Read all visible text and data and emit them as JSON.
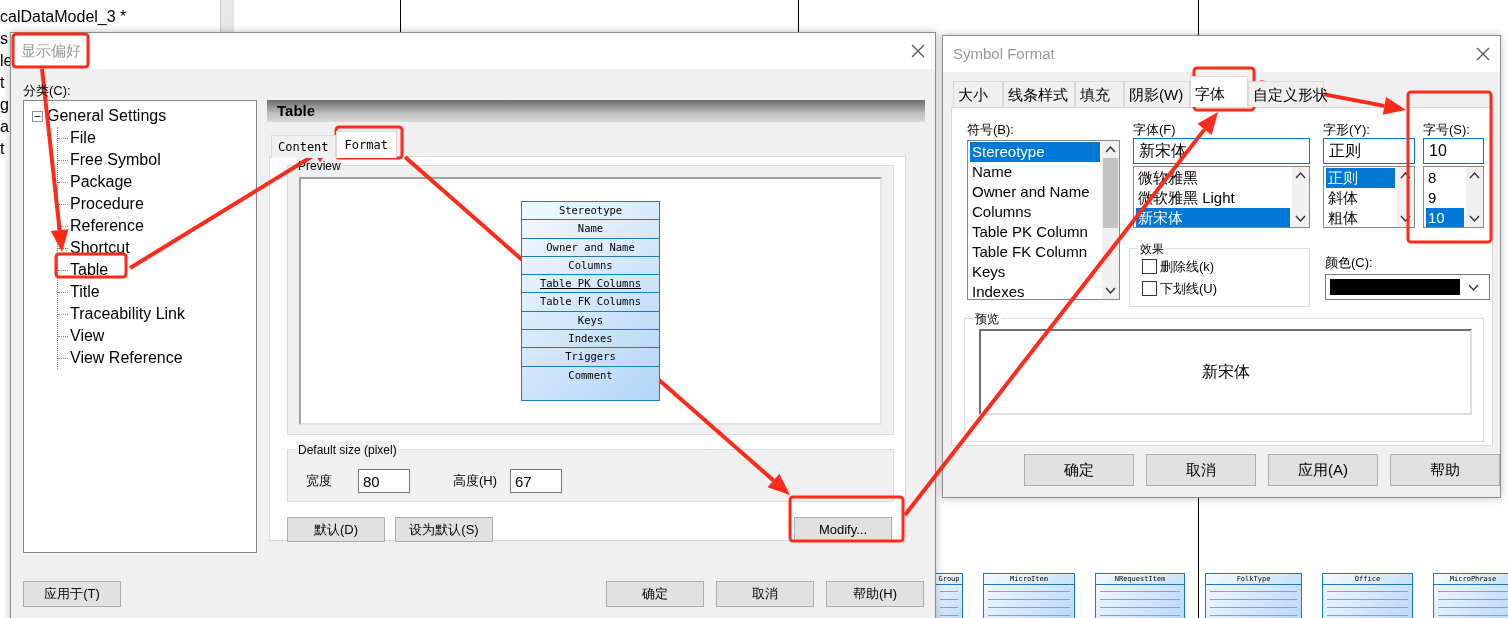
{
  "background": {
    "model_title": "calDataModel_3 *",
    "cut_labels": [
      "s",
      "le",
      "t",
      "g",
      "a",
      "t"
    ],
    "diagram_tables": [
      {
        "title": "Group"
      },
      {
        "title": "MicroItem"
      },
      {
        "title": "NRequestItem"
      },
      {
        "title": "FolkType"
      },
      {
        "title": "Office"
      },
      {
        "title": "MicroPhrase"
      }
    ]
  },
  "preferences_dialog": {
    "title": "显示偏好",
    "category_label": "分类(C):",
    "tree": [
      {
        "label": "General Settings",
        "expanded": true,
        "children": [
          {
            "label": "File"
          },
          {
            "label": "Free Symbol"
          },
          {
            "label": "Package"
          },
          {
            "label": "Procedure"
          },
          {
            "label": "Reference"
          },
          {
            "label": "Shortcut"
          },
          {
            "label": "Table"
          },
          {
            "label": "Title"
          },
          {
            "label": "Traceability Link"
          },
          {
            "label": "View"
          },
          {
            "label": "View Reference"
          }
        ]
      }
    ],
    "panel_title": "Table",
    "tabs": [
      {
        "label": "Content",
        "selected": false
      },
      {
        "label": "Format",
        "selected": true
      }
    ],
    "preview_label": "Preview",
    "symbol_rows": [
      {
        "label": "Stereotype",
        "underlined": false
      },
      {
        "label": "Name",
        "underlined": false
      },
      {
        "label": "Owner and Name",
        "underlined": false
      },
      {
        "label": "Columns",
        "underlined": false
      },
      {
        "label": "Table PK Columns",
        "underlined": true
      },
      {
        "label": "Table FK Columns",
        "underlined": false
      },
      {
        "label": "Keys",
        "underlined": false
      },
      {
        "label": "Indexes",
        "underlined": false
      },
      {
        "label": "Triggers",
        "underlined": false
      },
      {
        "label": "Comment",
        "underlined": false
      }
    ],
    "default_size": {
      "label": "Default size (pixel)",
      "fields": [
        {
          "label": "宽度",
          "value": "80"
        },
        {
          "label": "高度(H)",
          "value": "67"
        }
      ]
    },
    "panel_buttons": [
      "默认(D)",
      "设为默认(S)",
      "Modify..."
    ],
    "apply_to_button": "应用于(T)",
    "footer_buttons": [
      "确定",
      "取消",
      "帮助(H)"
    ]
  },
  "symbol_format_dialog": {
    "title": "Symbol Format",
    "tabs": [
      {
        "label": "大小",
        "selected": false
      },
      {
        "label": "线条样式",
        "selected": false
      },
      {
        "label": "填充",
        "selected": false
      },
      {
        "label": "阴影(W)",
        "selected": false
      },
      {
        "label": "字体",
        "selected": true
      },
      {
        "label": "自定义形状",
        "selected": false
      }
    ],
    "symbol_list": {
      "label": "符号(B):",
      "items": [
        {
          "label": "Stereotype",
          "selected": true
        },
        {
          "label": "Name",
          "selected": false
        },
        {
          "label": "Owner and Name",
          "selected": false
        },
        {
          "label": "Columns",
          "selected": false
        },
        {
          "label": "Table PK Column",
          "selected": false
        },
        {
          "label": "Table FK Column",
          "selected": false
        },
        {
          "label": "Keys",
          "selected": false
        },
        {
          "label": "Indexes",
          "selected": false
        }
      ]
    },
    "font": {
      "label": "字体(F)",
      "value": "新宋体",
      "items": [
        {
          "label": "微软雅黑",
          "selected": false
        },
        {
          "label": "微软雅黑 Light",
          "selected": false
        },
        {
          "label": "新宋体",
          "selected": true
        }
      ]
    },
    "style": {
      "label": "字形(Y):",
      "value": "正则",
      "items": [
        {
          "label": "正则",
          "selected": true
        },
        {
          "label": "斜体",
          "selected": false
        },
        {
          "label": "粗体",
          "selected": false
        }
      ]
    },
    "size": {
      "label": "字号(S):",
      "value": "10",
      "items": [
        {
          "label": "8",
          "selected": false
        },
        {
          "label": "9",
          "selected": false
        },
        {
          "label": "10",
          "selected": true
        }
      ]
    },
    "effects": {
      "label": "效果",
      "options": [
        {
          "label": "删除线(k)",
          "checked": false
        },
        {
          "label": "下划线(U)",
          "checked": false
        }
      ]
    },
    "color_field": {
      "label": "颜色(C):",
      "color": "#000000"
    },
    "preview": {
      "label": "预览",
      "sample": "新宋体"
    },
    "buttons": [
      "确定",
      "取消",
      "应用(A)",
      "帮助"
    ]
  }
}
